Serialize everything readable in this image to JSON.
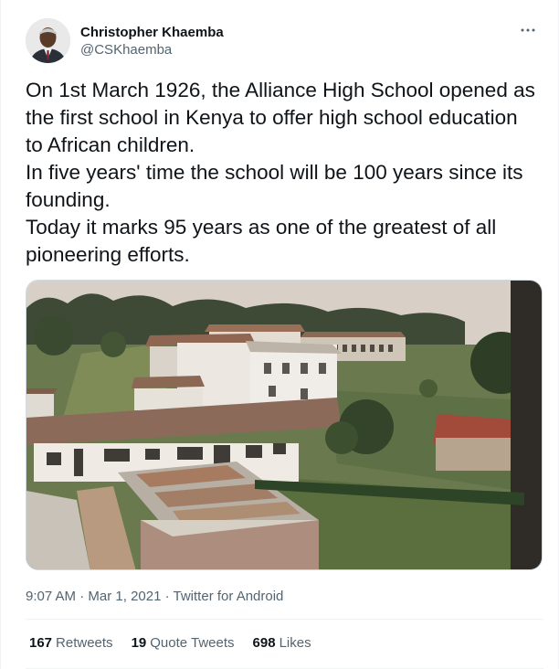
{
  "author": {
    "name": "Christopher Khaemba",
    "handle": "@CSKhaemba"
  },
  "tweet": {
    "lines": [
      "On 1st March 1926, the Alliance High School opened as",
      "the first school in Kenya to offer high school education",
      "to African children.",
      "In five years' time the school will be 100 years since its",
      "founding.",
      "Today it marks 95 years as one of the greatest of all",
      "pioneering efforts."
    ]
  },
  "meta": {
    "time": "9:07 AM",
    "separator": "·",
    "date": "Mar 1, 2021",
    "source": "Twitter for Android"
  },
  "stats": {
    "retweets": {
      "count": "167",
      "label": "Retweets"
    },
    "quotes": {
      "count": "19",
      "label": "Quote Tweets"
    },
    "likes": {
      "count": "698",
      "label": "Likes"
    }
  },
  "colors": {
    "text": "#0f1419",
    "secondary": "#536471",
    "divider": "#eff3f4"
  },
  "icons": {
    "more": "more-horizontal-icon"
  }
}
